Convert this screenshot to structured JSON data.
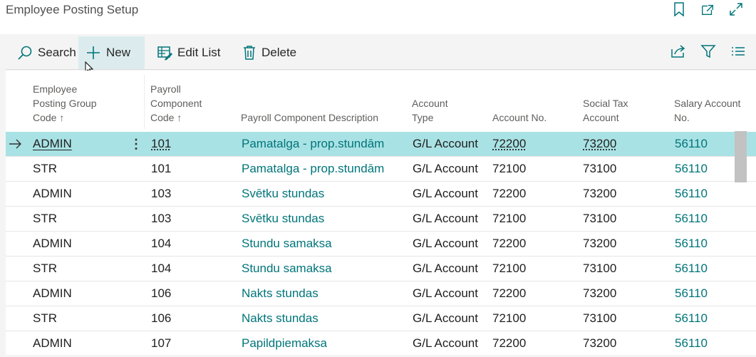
{
  "page": {
    "title": "Employee Posting Setup"
  },
  "title_icons": [
    "bookmark-icon",
    "open-new-window-icon",
    "expand-icon"
  ],
  "toolbar": {
    "search_label": "Search",
    "new_label": "New",
    "edit_list_label": "Edit List",
    "delete_label": "Delete",
    "right_icons": [
      "share-icon",
      "filter-icon",
      "list-view-icon"
    ]
  },
  "columns": {
    "group_code": [
      "Employee",
      "Posting Group",
      "Code ↑"
    ],
    "component_code": [
      "Payroll",
      "Component",
      "Code ↑"
    ],
    "description": [
      "Payroll Component Description"
    ],
    "account_type": [
      "Account",
      "Type"
    ],
    "account_no": [
      "Account No."
    ],
    "social_tax": [
      "Social Tax",
      "Account"
    ],
    "salary_account": [
      "Salary Account",
      "No."
    ]
  },
  "rows": [
    {
      "group": "ADMIN",
      "code": "101",
      "description": "Pamatalga - prop.stundām",
      "type": "G/L Account",
      "account_no": "72200",
      "social_tax": "73200",
      "salary": "56110",
      "selected": true
    },
    {
      "group": "STR",
      "code": "101",
      "description": "Pamatalga - prop.stundām",
      "type": "G/L Account",
      "account_no": "72100",
      "social_tax": "73100",
      "salary": "56110"
    },
    {
      "group": "ADMIN",
      "code": "103",
      "description": "Svētku stundas",
      "type": "G/L Account",
      "account_no": "72200",
      "social_tax": "73200",
      "salary": "56110"
    },
    {
      "group": "STR",
      "code": "103",
      "description": "Svētku stundas",
      "type": "G/L Account",
      "account_no": "72100",
      "social_tax": "73100",
      "salary": "56110"
    },
    {
      "group": "ADMIN",
      "code": "104",
      "description": "Stundu samaksa",
      "type": "G/L Account",
      "account_no": "72200",
      "social_tax": "73200",
      "salary": "56110"
    },
    {
      "group": "STR",
      "code": "104",
      "description": "Stundu samaksa",
      "type": "G/L Account",
      "account_no": "72100",
      "social_tax": "73100",
      "salary": "56110"
    },
    {
      "group": "ADMIN",
      "code": "106",
      "description": "Nakts stundas",
      "type": "G/L Account",
      "account_no": "72200",
      "social_tax": "73200",
      "salary": "56110"
    },
    {
      "group": "STR",
      "code": "106",
      "description": "Nakts stundas",
      "type": "G/L Account",
      "account_no": "72100",
      "social_tax": "73100",
      "salary": "56110"
    },
    {
      "group": "ADMIN",
      "code": "107",
      "description": "Papildpiemaksa",
      "type": "G/L Account",
      "account_no": "72200",
      "social_tax": "73200",
      "salary": "56110"
    }
  ],
  "colors": {
    "accent": "#00757a",
    "selected_row": "#a9e2e4",
    "hover": "#dcecee"
  }
}
